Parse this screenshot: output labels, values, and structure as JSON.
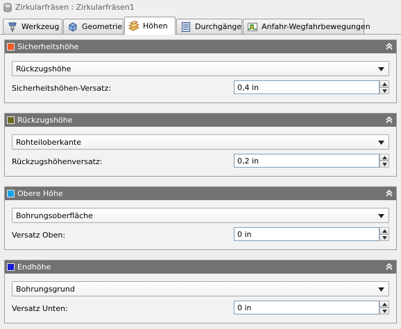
{
  "window": {
    "title": "Zirkularfräsen : Zirkularfräsen1",
    "icon": "database-stack-icon"
  },
  "tabs": [
    {
      "label": "Werkzeug",
      "icon": "tool-holder-icon",
      "active": false
    },
    {
      "label": "Geometrie",
      "icon": "cube-geometry-icon",
      "active": false
    },
    {
      "label": "Höhen",
      "icon": "stacked-planes-icon",
      "active": true
    },
    {
      "label": "Durchgänge",
      "icon": "passes-document-icon",
      "active": false
    },
    {
      "label": "Anfahr-Wegfahrbewegungen",
      "icon": "linking-moves-icon",
      "active": false
    }
  ],
  "panels": [
    {
      "title": "Sicherheitshöhe",
      "color": "#f05a28",
      "dropdown_value": "Rückzugshöhe",
      "field_label": "Sicherheitshöhen-Versatz:",
      "field_value": "0,4 in"
    },
    {
      "title": "Rückzugshöhe",
      "color": "#6b6b1f",
      "dropdown_value": "Rohteiloberkante",
      "field_label": "Rückzugshöhenversatz:",
      "field_value": "0,2 in"
    },
    {
      "title": "Obere Höhe",
      "color": "#1aa3e8",
      "dropdown_value": "Bohrungsoberfläche",
      "field_label": "Versatz Oben:",
      "field_value": "0 in"
    },
    {
      "title": "Endhöhe",
      "color": "#1a1ad6",
      "dropdown_value": "Bohrungsgrund",
      "field_label": "Versatz Unten:",
      "field_value": "0 in"
    }
  ]
}
